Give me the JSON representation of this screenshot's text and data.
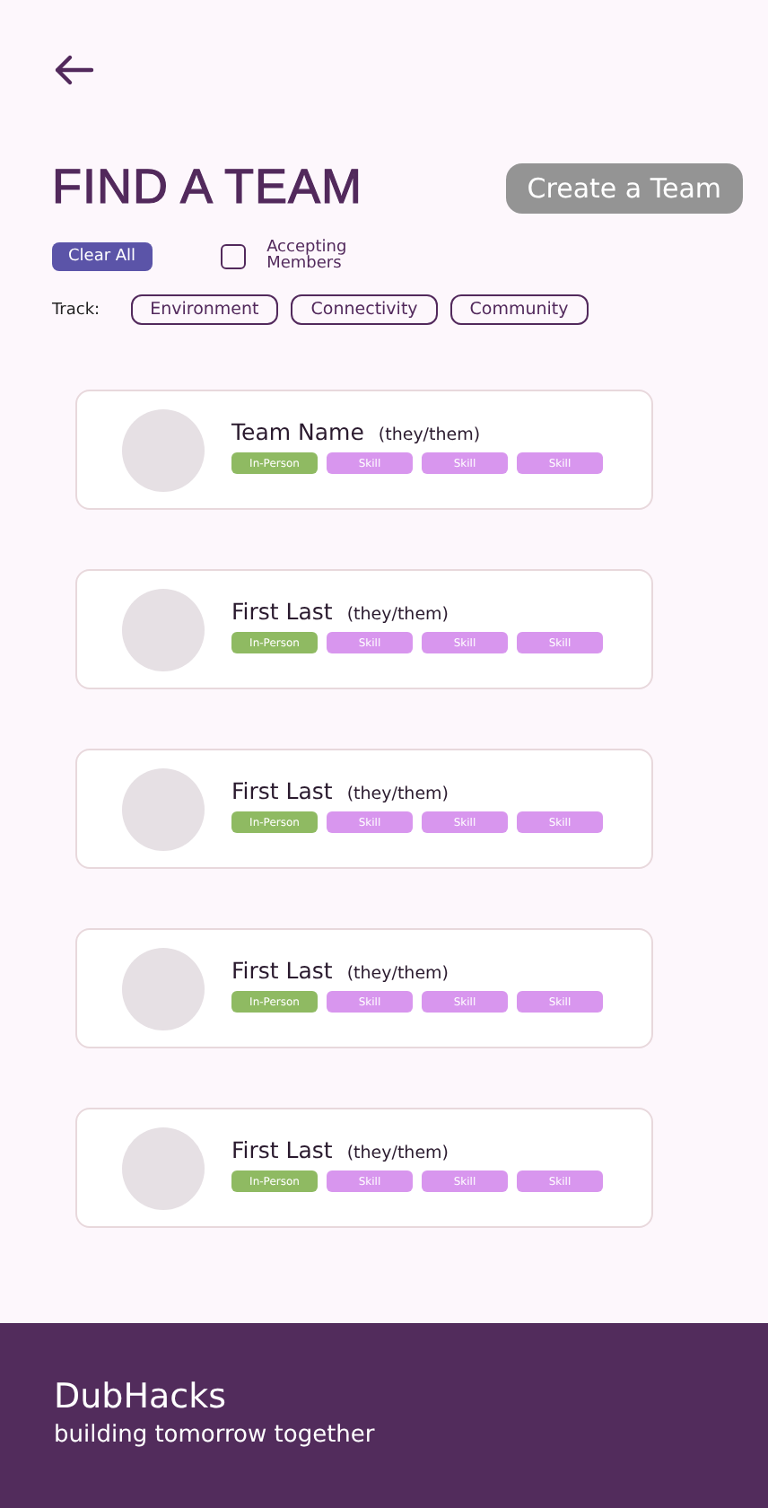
{
  "title": "FIND A TEAM",
  "create_button": {
    "label": "Create a Team",
    "disabled": true
  },
  "clear_button": {
    "label": "Clear All"
  },
  "accepting_members": {
    "label": "Accepting Members",
    "checked": false
  },
  "track": {
    "label": "Track:",
    "options": [
      {
        "label": "Environment",
        "selected": false
      },
      {
        "label": "Connectivity",
        "selected": false
      },
      {
        "label": "Community",
        "selected": false
      }
    ]
  },
  "cards": [
    {
      "name": "Team Name",
      "pronouns": "(they/them)",
      "tags": [
        {
          "label": "In-Person",
          "kind": "mode"
        },
        {
          "label": "Skill",
          "kind": "skill"
        },
        {
          "label": "Skill",
          "kind": "skill"
        },
        {
          "label": "Skill",
          "kind": "skill"
        }
      ]
    },
    {
      "name": "First Last",
      "pronouns": "(they/them)",
      "tags": [
        {
          "label": "In-Person",
          "kind": "mode"
        },
        {
          "label": "Skill",
          "kind": "skill"
        },
        {
          "label": "Skill",
          "kind": "skill"
        },
        {
          "label": "Skill",
          "kind": "skill"
        }
      ]
    },
    {
      "name": "First Last",
      "pronouns": "(they/them)",
      "tags": [
        {
          "label": "In-Person",
          "kind": "mode"
        },
        {
          "label": "Skill",
          "kind": "skill"
        },
        {
          "label": "Skill",
          "kind": "skill"
        },
        {
          "label": "Skill",
          "kind": "skill"
        }
      ]
    },
    {
      "name": "First Last",
      "pronouns": "(they/them)",
      "tags": [
        {
          "label": "In-Person",
          "kind": "mode"
        },
        {
          "label": "Skill",
          "kind": "skill"
        },
        {
          "label": "Skill",
          "kind": "skill"
        },
        {
          "label": "Skill",
          "kind": "skill"
        }
      ]
    },
    {
      "name": "First Last",
      "pronouns": "(they/them)",
      "tags": [
        {
          "label": "In-Person",
          "kind": "mode"
        },
        {
          "label": "Skill",
          "kind": "skill"
        },
        {
          "label": "Skill",
          "kind": "skill"
        },
        {
          "label": "Skill",
          "kind": "skill"
        }
      ]
    }
  ],
  "footer": {
    "brand": "DubHacks",
    "tagline": "building tomorrow together"
  }
}
